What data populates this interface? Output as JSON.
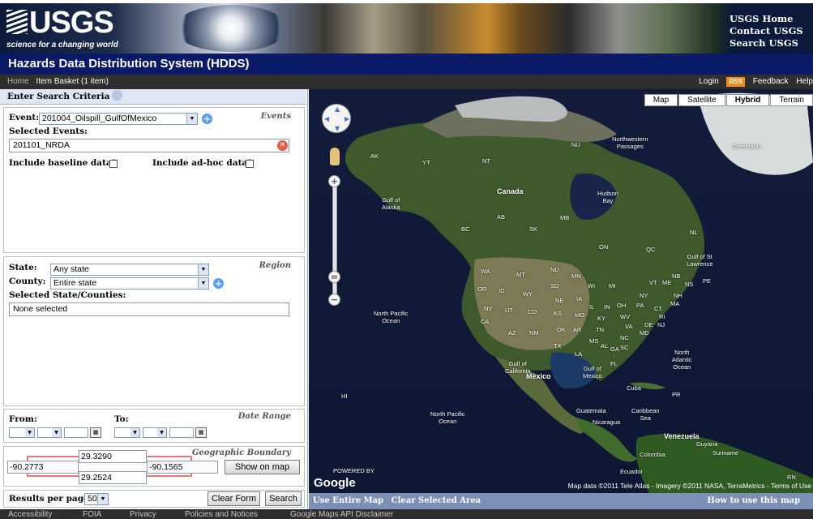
{
  "banner": {
    "logo": "USGS",
    "tagline": "science for a changing world",
    "links": [
      "USGS Home",
      "Contact USGS",
      "Search USGS"
    ]
  },
  "app_title": "Hazards Data Distribution System (HDDS)",
  "nav": {
    "home": "Home",
    "basket": "Item Basket (1 item)",
    "login": "Login",
    "rss": "RSS",
    "feedback": "Feedback",
    "help": "Help"
  },
  "search": {
    "header": "Enter Search Criteria",
    "events": {
      "section_title": "Events",
      "event_label": "Event:",
      "event_value": "201004_Oilspill_GulfOfMexico",
      "selected_label": "Selected Events:",
      "selected_value": "201101_NRDA",
      "baseline_label": "Include baseline data?",
      "adhoc_label": "Include ad-hoc data?"
    },
    "region": {
      "section_title": "Region",
      "state_label": "State:",
      "state_value": "Any state",
      "county_label": "County:",
      "county_value": "Entire state",
      "selected_label": "Selected State/Counties:",
      "selected_value": "None selected"
    },
    "date": {
      "section_title": "Date Range",
      "from_label": "From:",
      "to_label": "To:"
    },
    "geo": {
      "section_title": "Geographic Boundary",
      "north": "29.3290",
      "west": "-90.2773",
      "east": "-90.1565",
      "south": "29.2524",
      "show_on_map": "Show on map"
    },
    "results": {
      "label": "Results per page",
      "value": "50",
      "clear_form": "Clear Form",
      "search": "Search"
    }
  },
  "map": {
    "types": [
      "Map",
      "Satellite",
      "Hybrid",
      "Terrain"
    ],
    "active_type": "Hybrid",
    "labels": {
      "canada": "Canada",
      "north_pacific_1": "North Pacific\nOcean",
      "north_pacific_2": "North Pacific\nOcean",
      "north_atlantic": "North\nAtlantic\nOcean",
      "gulf_alaska": "Gulf of\nAlaska",
      "hudson_bay": "Hudson\nBay",
      "northwestern_passages": "Northwestern\nPassages",
      "greenland": "Greenland",
      "mexico": "México",
      "gulf_mexico": "Gulf of\nMexico",
      "gulf_california": "Gulf of\nCalifornia",
      "gulf_st_lawrence": "Gulf of St\nLawrence",
      "cuba": "Cuba",
      "caribbean": "Caribbean\nSea",
      "venezuela": "Venezuela",
      "colombia": "Colombia",
      "guatemala": "Guatemala",
      "nicaragua": "Nicaragua",
      "guyana": "Guyana",
      "suriname": "Suriname",
      "ecuador": "Ecuador",
      "ak": "AK",
      "yt": "YT",
      "nt": "NT",
      "nu": "NU",
      "bc": "BC",
      "ab": "AB",
      "sk": "SK",
      "mb": "MB",
      "on": "ON",
      "qc": "QC",
      "nl": "NL",
      "nb": "NB",
      "pe": "PE",
      "ns": "NS",
      "wa": "WA",
      "mt": "MT",
      "nd": "ND",
      "mn": "MN",
      "or": "OR",
      "id": "ID",
      "wy": "WY",
      "sd": "SD",
      "wi": "WI",
      "mi": "MI",
      "ny": "NY",
      "vt": "VT",
      "me": "ME",
      "nh": "NH",
      "ma": "MA",
      "nv": "NV",
      "ut": "UT",
      "co": "CO",
      "ne": "NE",
      "ia": "IA",
      "il": "IL",
      "in": "IN",
      "oh": "OH",
      "pa": "PA",
      "ct": "CT",
      "ri": "RI",
      "ca": "CA",
      "az": "AZ",
      "nm": "NM",
      "ks": "KS",
      "mo": "MO",
      "ky": "KY",
      "wv": "WV",
      "va": "VA",
      "de": "DE",
      "nj": "NJ",
      "md": "MD",
      "ok": "OK",
      "ar": "AR",
      "tn": "TN",
      "nc": "NC",
      "tx": "TX",
      "la": "LA",
      "ms": "MS",
      "al": "AL",
      "ga": "GA",
      "sc": "SC",
      "fl": "FL",
      "hi": "HI",
      "pr": "PR",
      "rn": "RN"
    },
    "powered_by": "POWERED BY",
    "google": "Google",
    "attribution": "Map data ©2011 Tele Atlas - Imagery ©2011 NASA, TerraMetrics - Terms of Use",
    "use_entire_map": "Use Entire Map",
    "clear_selected_area": "Clear Selected Area",
    "how_to_use": "How to use this map"
  },
  "footer": [
    "Accessibility",
    "FOIA",
    "Privacy",
    "Policies and Notices",
    "Google Maps API Disclaimer"
  ]
}
